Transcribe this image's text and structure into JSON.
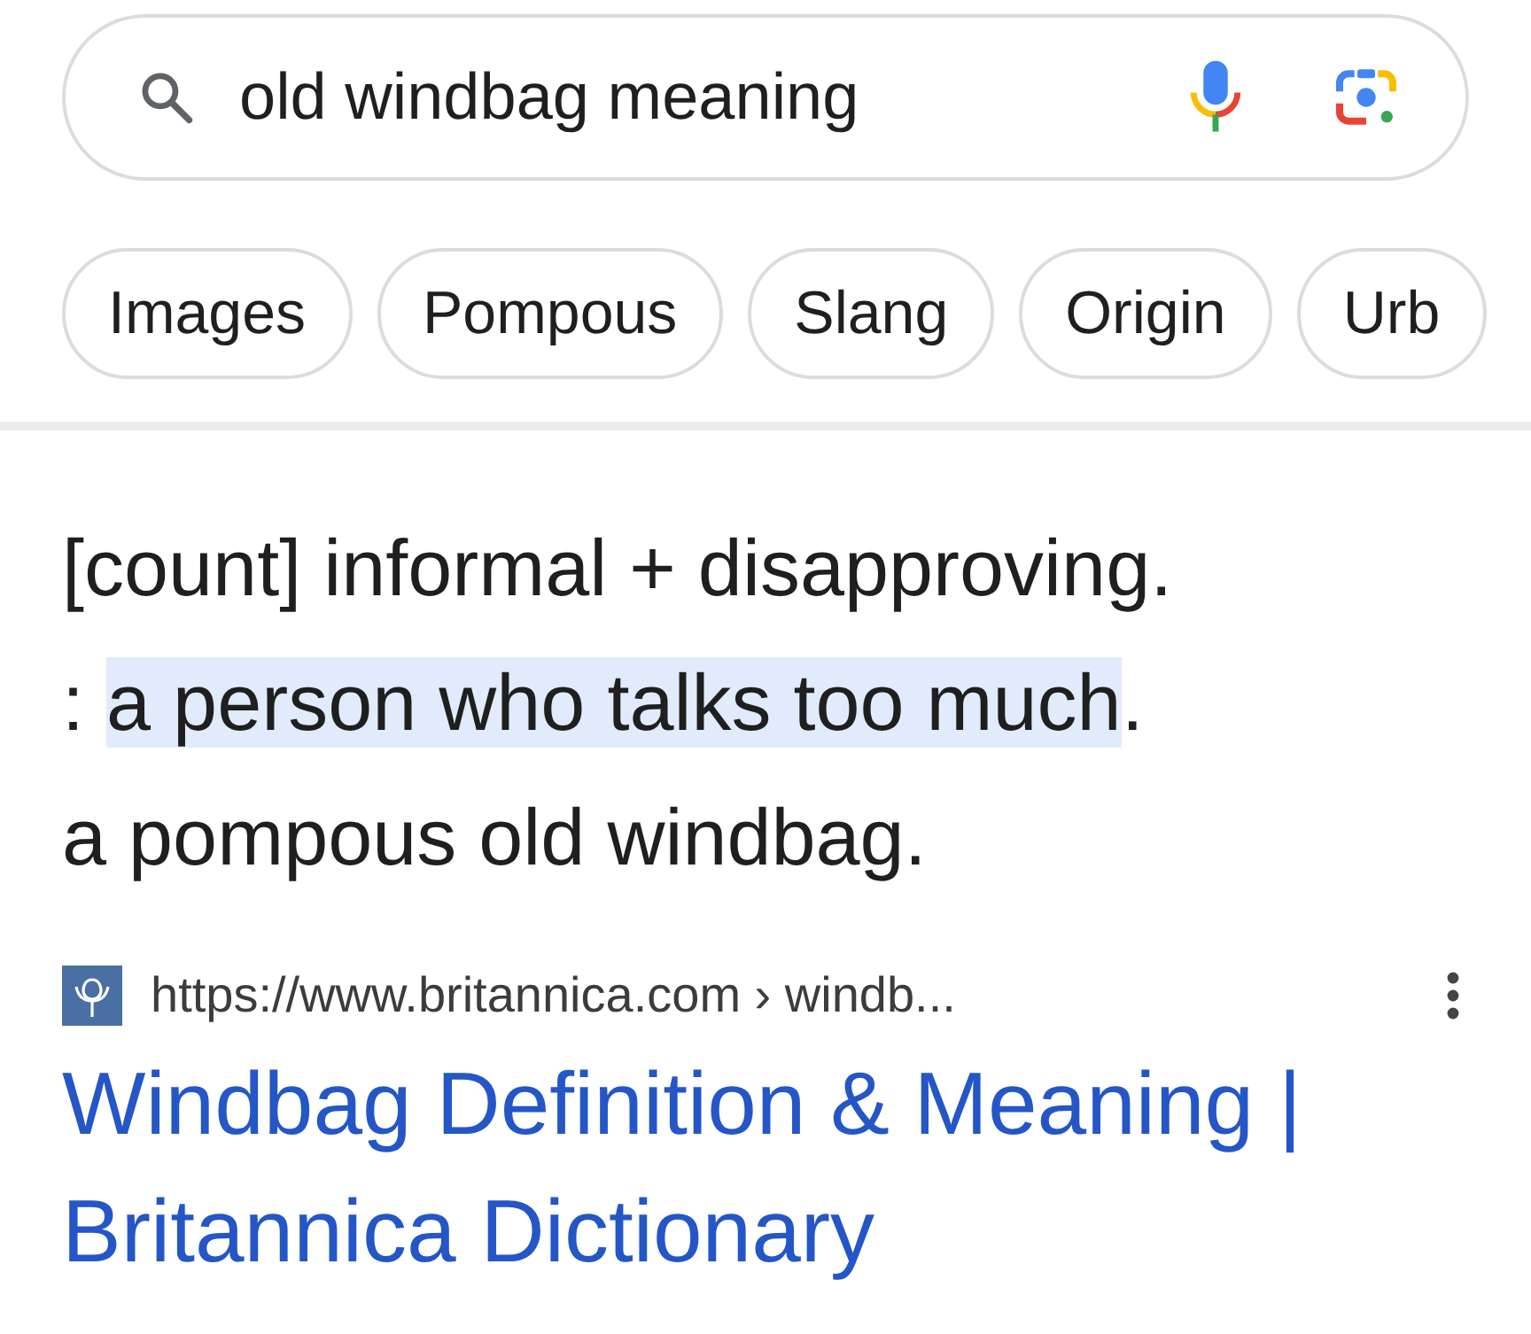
{
  "search": {
    "query": "old windbag meaning"
  },
  "chips": [
    {
      "label": "Images"
    },
    {
      "label": "Pompous"
    },
    {
      "label": "Slang"
    },
    {
      "label": "Origin"
    },
    {
      "label": "Urb"
    }
  ],
  "definition": {
    "lines": [
      {
        "segments": [
          {
            "text": "[count] informal + disapproving.",
            "highlighted": false
          }
        ]
      },
      {
        "segments": [
          {
            "text": ": ",
            "highlighted": false
          },
          {
            "text": "a person who talks too much",
            "highlighted": true
          },
          {
            "text": ".",
            "highlighted": false
          }
        ]
      },
      {
        "segments": [
          {
            "text": "a pompous old windbag.",
            "highlighted": false
          }
        ]
      }
    ]
  },
  "result": {
    "url": "https://www.britannica.com › windb...",
    "title": "Windbag Definition & Meaning | Britannica Dictionary"
  }
}
